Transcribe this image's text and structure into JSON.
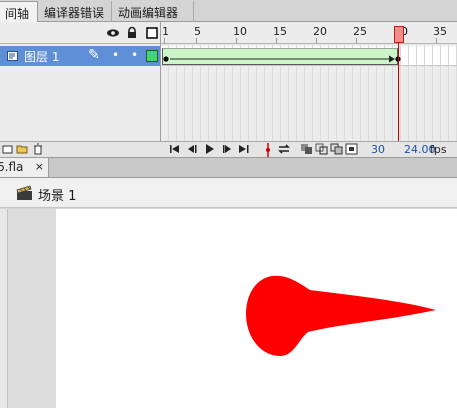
{
  "tabs": [
    {
      "label": "间轴"
    },
    {
      "label": "编译器错误"
    },
    {
      "label": "动画编辑器"
    }
  ],
  "timeline": {
    "ruler_labels": [
      "1",
      "5",
      "10",
      "15",
      "20",
      "25",
      "30",
      "35"
    ],
    "layer": {
      "name": "图层 1",
      "pencil": "✎",
      "eye_dot": "•",
      "lock_dot": "•"
    },
    "current_frame": "30",
    "frame_rate": "24.00",
    "frame_rate_unit": "fps"
  },
  "document": {
    "tab_label": "6.fla",
    "close_label": "×",
    "scene_label": "场景 1"
  },
  "icons": [
    "eye-icon",
    "lock-icon",
    "outline-icon",
    "layer-icon",
    "pencil-icon",
    "new-layer-icon",
    "new-folder-icon",
    "delete-icon",
    "first-frame-icon",
    "prev-frame-icon",
    "play-icon",
    "next-frame-icon",
    "last-frame-icon",
    "loop-icon",
    "onion-skin-icon",
    "onion-outline-icon",
    "edit-multiple-icon",
    "onion-markers-icon",
    "scene-icon",
    "close-icon"
  ],
  "colors": {
    "layer_selected": "#5f8fd6",
    "tween_fill": "#ccf5c8",
    "playhead": "#d10000",
    "shape_fill": "#ff0000"
  }
}
